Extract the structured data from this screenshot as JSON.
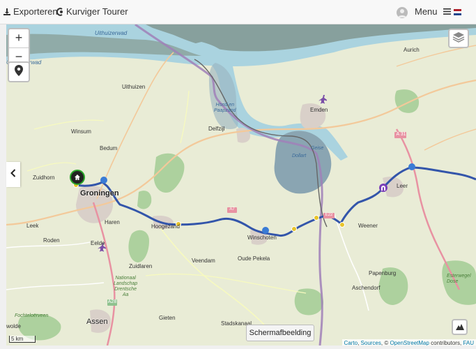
{
  "toolbar": {
    "export_label": "Exporteren",
    "brand_label": "Kurviger Tourer",
    "menu_label": "Menu"
  },
  "map": {
    "zoom_in": "+",
    "zoom_out": "−",
    "screenshot_label": "Schermafbeelding",
    "scale_label": "5 km",
    "attribution": {
      "carto": "Carto",
      "sources": "Sources",
      "osm": "OpenStreetMap",
      "contributors": "contributors,",
      "fau": "FAU"
    },
    "places": {
      "uithuizen": "Uithuizen",
      "delfzijl": "Delfzijl",
      "winsum": "Winsum",
      "bedum": "Bedum",
      "zuidhorn": "Zuidhorn",
      "groningen": "Groningen",
      "leek": "Leek",
      "roden": "Roden",
      "haren": "Haren",
      "eelde": "Eelde",
      "zuidlaren": "Zuidlaren",
      "hoogezand": "Hoogezand",
      "veendam": "Veendam",
      "oude_pekela": "Oude Pekela",
      "winschoten": "Winschoten",
      "stadskanaal": "Stadskanaal",
      "gieten": "Gieten",
      "assen": "Assen",
      "emden": "Emden",
      "aurich": "Aurich",
      "leer": "Leer",
      "weener": "Weener",
      "papenburg": "Papenburg",
      "aschendorf": "Aschendorf",
      "uithuizerwad": "Uithuizerwad",
      "groningerwad": "Groningerwad",
      "hond_paapzand": "Hond en\nPaapzand",
      "dollart": "Dollart",
      "geise": "Geise",
      "national_park": "Nationaal\nLandschap\nDrentsche\nAa",
      "fochteloerveen": "Fochteloërveen",
      "esterwege": "Esterwegel\nDose",
      "wolde": "wolde",
      "a31": "A 31",
      "a28": "A28",
      "a7": "A7",
      "e22": "E22"
    }
  }
}
